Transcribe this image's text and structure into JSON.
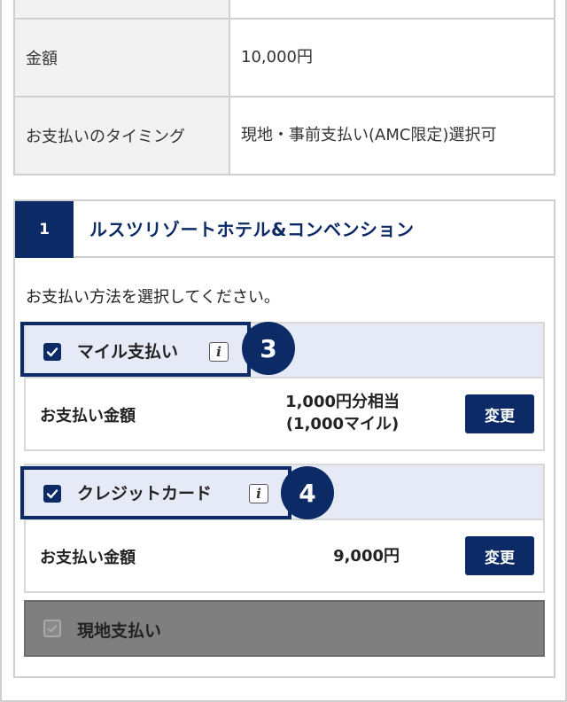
{
  "info_table": {
    "rows": [
      {
        "label": "金額",
        "value": "10,000円"
      },
      {
        "label": "お支払いのタイミング",
        "value": "現地・事前支払い(AMC限定)選択可"
      }
    ]
  },
  "hotel": {
    "number": "1",
    "name": "ルスツリゾートホテル&コンベンション",
    "instruction": "お支払い方法を選択してください。"
  },
  "payments": {
    "miles": {
      "label": "マイル支払い",
      "checked": true,
      "amount_label": "お支払い金額",
      "amount_line1": "1,000円分相当",
      "amount_line2": "(1,000マイル)",
      "change_label": "変更",
      "step": "3"
    },
    "credit": {
      "label": "クレジットカード",
      "checked": true,
      "amount_label": "お支払い金額",
      "amount": "9,000円",
      "change_label": "変更",
      "step": "4"
    },
    "onsite": {
      "label": "現地支払い",
      "checked": true,
      "disabled": true
    }
  },
  "icons": {
    "checkbox": "check-icon",
    "info": "info-icon"
  },
  "colors": {
    "brand_navy": "#0b2a66",
    "header_bg": "#e6eaf6",
    "disabled_bg": "#7f7f7f"
  }
}
